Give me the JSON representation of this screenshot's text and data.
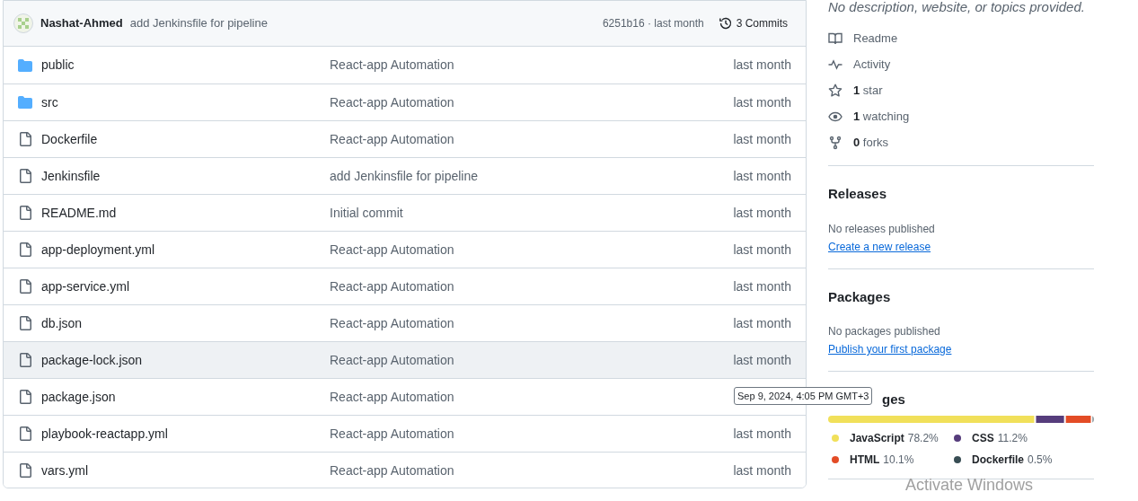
{
  "commit_bar": {
    "author": "Nashat-Ahmed",
    "message": "add Jenkinsfile for pipeline",
    "hash_time": "6251b16 · last month",
    "commits": "3 Commits"
  },
  "files": [
    {
      "kind": "folder",
      "name": "public",
      "message": "React-app Automation",
      "time": "last month",
      "hovered": false
    },
    {
      "kind": "folder",
      "name": "src",
      "message": "React-app Automation",
      "time": "last month",
      "hovered": false
    },
    {
      "kind": "file",
      "name": "Dockerfile",
      "message": "React-app Automation",
      "time": "last month",
      "hovered": false
    },
    {
      "kind": "file",
      "name": "Jenkinsfile",
      "message": "add Jenkinsfile for pipeline",
      "time": "last month",
      "hovered": false
    },
    {
      "kind": "file",
      "name": "README.md",
      "message": "Initial commit",
      "time": "last month",
      "hovered": false
    },
    {
      "kind": "file",
      "name": "app-deployment.yml",
      "message": "React-app Automation",
      "time": "last month",
      "hovered": false
    },
    {
      "kind": "file",
      "name": "app-service.yml",
      "message": "React-app Automation",
      "time": "last month",
      "hovered": false
    },
    {
      "kind": "file",
      "name": "db.json",
      "message": "React-app Automation",
      "time": "last month",
      "hovered": false
    },
    {
      "kind": "file",
      "name": "package-lock.json",
      "message": "React-app Automation",
      "time": "last month",
      "hovered": true
    },
    {
      "kind": "file",
      "name": "package.json",
      "message": "React-app Automation",
      "hovered": false
    },
    {
      "kind": "file",
      "name": "playbook-reactapp.yml",
      "message": "React-app Automation",
      "time": "last month",
      "hovered": false
    },
    {
      "kind": "file",
      "name": "vars.yml",
      "message": "React-app Automation",
      "time": "last month",
      "hovered": false
    }
  ],
  "tooltip": "Sep 9, 2024, 4:05 PM GMT+3",
  "about": {
    "description": "No description, website, or topics provided.",
    "links": [
      {
        "kind": "book",
        "label": "Readme"
      },
      {
        "kind": "pulse",
        "label": "Activity"
      },
      {
        "kind": "star",
        "count": "1",
        "label": "star"
      },
      {
        "kind": "eye",
        "count": "1",
        "label": "watching"
      },
      {
        "kind": "fork",
        "count": "0",
        "label": "forks"
      }
    ]
  },
  "releases": {
    "title": "Releases",
    "note": "No releases published",
    "link": "Create a new release"
  },
  "packages": {
    "title": "Packages",
    "note": "No packages published",
    "link": "Publish your first package"
  },
  "languages": {
    "title": "ges",
    "items": [
      {
        "name": "JavaScript",
        "percent": "78.2%",
        "color": "#f1e05a"
      },
      {
        "name": "CSS",
        "percent": "11.2%",
        "color": "#563d7c"
      },
      {
        "name": "HTML",
        "percent": "10.1%",
        "color": "#e34c26"
      },
      {
        "name": "Dockerfile",
        "percent": "0.5%",
        "color": "#384d54"
      }
    ]
  },
  "os_overlay": "Activate Windows"
}
